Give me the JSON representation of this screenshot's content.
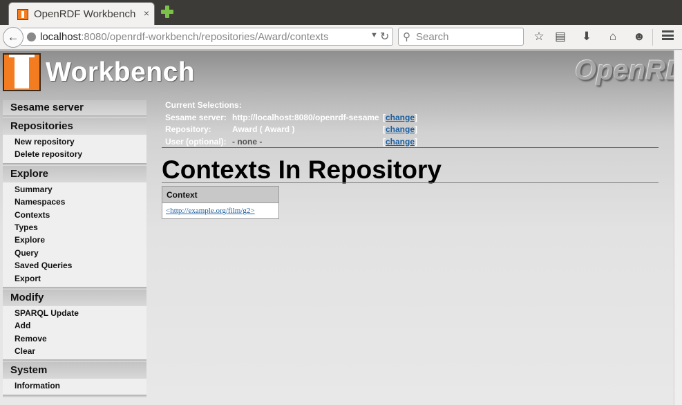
{
  "browser": {
    "tab_title": "OpenRDF Workbench",
    "tab_close": "×",
    "url_host": "localhost",
    "url_path": ":8080/openrdf-workbench/repositories/Award/contexts",
    "search_placeholder": "Search"
  },
  "header": {
    "logo_text": "Workbench",
    "brand_text": "OpenRDF"
  },
  "sidebar": {
    "sections": [
      {
        "title": "Sesame server",
        "items": []
      },
      {
        "title": "Repositories",
        "items": [
          "New repository",
          "Delete repository"
        ]
      },
      {
        "title": "Explore",
        "items": [
          "Summary",
          "Namespaces",
          "Contexts",
          "Types",
          "Explore",
          "Query",
          "Saved Queries",
          "Export"
        ]
      },
      {
        "title": "Modify",
        "items": [
          "SPARQL Update",
          "Add",
          "Remove",
          "Clear"
        ]
      },
      {
        "title": "System",
        "items": [
          "Information"
        ]
      }
    ]
  },
  "selections": {
    "heading": "Current Selections:",
    "server_label": "Sesame server:",
    "server_value": "http://localhost:8080/openrdf-sesame",
    "repo_label": "Repository:",
    "repo_value": "Award ( Award )",
    "user_label": "User (optional):",
    "user_value": "- none -",
    "change_label": "change"
  },
  "main": {
    "title": "Contexts In Repository",
    "table_header": "Context",
    "rows": [
      "<http://example.org/film/g2>"
    ]
  }
}
